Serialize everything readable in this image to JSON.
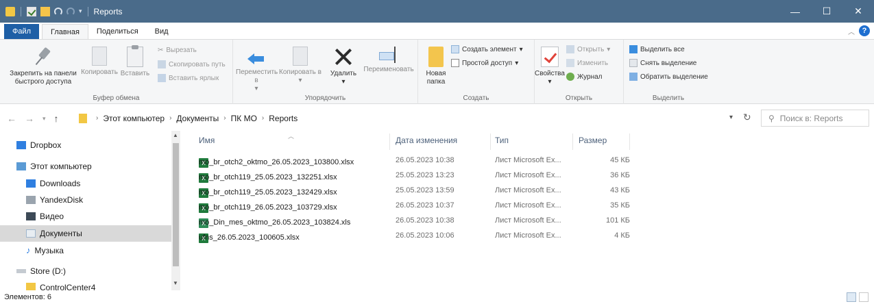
{
  "window": {
    "title": "Reports"
  },
  "ribbon_tabs": {
    "file": "Файл",
    "home": "Главная",
    "share": "Поделиться",
    "view": "Вид"
  },
  "clipboard": {
    "pin": "Закрепить на панели быстрого доступа",
    "copy": "Копировать",
    "paste": "Вставить",
    "cut": "Вырезать",
    "copy_path": "Скопировать путь",
    "paste_shortcut": "Вставить ярлык",
    "label": "Буфер обмена"
  },
  "organize": {
    "move_to": "Переместить в",
    "copy_to": "Копировать в",
    "delete": "Удалить",
    "rename": "Переименовать",
    "label": "Упорядочить"
  },
  "create": {
    "new_folder": "Новая папка",
    "new_item": "Создать элемент",
    "easy_access": "Простой доступ",
    "label": "Создать"
  },
  "open": {
    "properties": "Свойства",
    "open": "Открыть",
    "edit": "Изменить",
    "history": "Журнал",
    "label": "Открыть"
  },
  "select": {
    "select_all": "Выделить все",
    "select_none": "Снять выделение",
    "invert": "Обратить выделение",
    "label": "Выделить"
  },
  "address": {
    "crumbs": [
      "Этот компьютер",
      "Документы",
      "ПК МО",
      "Reports"
    ],
    "search_placeholder": "Поиск в: Reports"
  },
  "nav": {
    "items": [
      "Dropbox",
      "Этот компьютер",
      "Downloads",
      "YandexDisk",
      "Видео",
      "Документы",
      "Музыка",
      "Store (D:)",
      "ControlCenter4"
    ]
  },
  "columns": {
    "name": "Имя",
    "date": "Дата изменения",
    "type": "Тип",
    "size": "Размер"
  },
  "files": [
    {
      "name": "mo_br_otch2_oktmo_26.05.2023_103800.xlsx",
      "date": "26.05.2023 10:38",
      "type": "Лист Microsoft Ex...",
      "size": "45 КБ"
    },
    {
      "name": "mo_br_otch119_25.05.2023_132251.xlsx",
      "date": "25.05.2023 13:23",
      "type": "Лист Microsoft Ex...",
      "size": "36 КБ"
    },
    {
      "name": "mo_br_otch119_25.05.2023_132429.xlsx",
      "date": "25.05.2023 13:59",
      "type": "Лист Microsoft Ex...",
      "size": "43 КБ"
    },
    {
      "name": "mo_br_otch119_26.05.2023_103729.xlsx",
      "date": "26.05.2023 10:37",
      "type": "Лист Microsoft Ex...",
      "size": "35 КБ"
    },
    {
      "name": "mo_Din_mes_oktmo_26.05.2023_103824.xls",
      "date": "26.05.2023 10:38",
      "type": "Лист Microsoft Ex...",
      "size": "101 КБ"
    },
    {
      "name": "ufns_26.05.2023_100605.xlsx",
      "date": "26.05.2023 10:06",
      "type": "Лист Microsoft Ex...",
      "size": "4 КБ"
    }
  ],
  "status": {
    "items": "Элементов: 6"
  },
  "colors": {
    "titlebar": "#4a6b8a",
    "file_tab": "#1e5fa6",
    "selection": "#d9d9d9"
  }
}
